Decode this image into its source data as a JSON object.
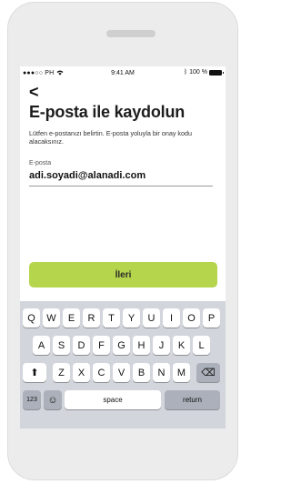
{
  "status_bar": {
    "carrier": "●●●○○ PH",
    "wifi_icon": "wifi-icon",
    "time": "9:41 AM",
    "battery": "100 %"
  },
  "header": {
    "back_glyph": "<",
    "title": "E-posta ile kaydolun",
    "description": "Lütfen e-postanızı belirtin. E-posta yoluyla bir onay kodu alacaksınız."
  },
  "form": {
    "email_label": "E-posta",
    "email_value": "adi.soyadi@alanadi.com"
  },
  "next_button": {
    "label": "İleri",
    "color": "#b5d54c"
  },
  "keyboard": {
    "row1": [
      "Q",
      "W",
      "E",
      "R",
      "T",
      "Y",
      "U",
      "I",
      "O",
      "P"
    ],
    "row2": [
      "A",
      "S",
      "D",
      "F",
      "G",
      "H",
      "J",
      "K",
      "L"
    ],
    "row3": [
      "Z",
      "X",
      "C",
      "V",
      "B",
      "N",
      "M"
    ],
    "shift_glyph": "⬆",
    "delete_glyph": "⌫",
    "numbers_label": "123",
    "emoji_glyph": "☺",
    "space_label": "space",
    "return_label": "return"
  }
}
